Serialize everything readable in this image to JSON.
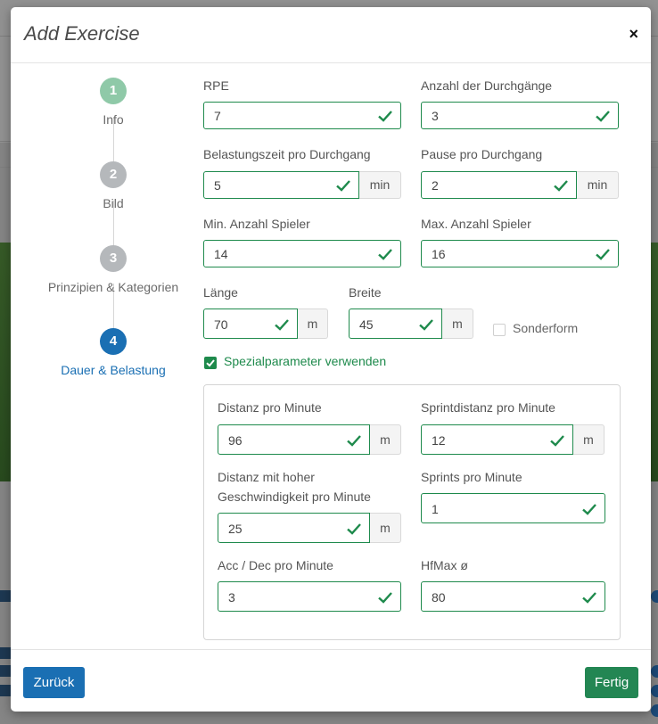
{
  "modal": {
    "title": "Add Exercise",
    "close": "×"
  },
  "steps": [
    {
      "num": "1",
      "label": "Info",
      "state": "done",
      "color": "#8fc9a8"
    },
    {
      "num": "2",
      "label": "Bild",
      "state": "inactive",
      "color": "#b5b8bb"
    },
    {
      "num": "3",
      "label": "Prinzipien & Kategorien",
      "state": "inactive",
      "color": "#b5b8bb"
    },
    {
      "num": "4",
      "label": "Dauer & Belastung",
      "state": "active",
      "color": "#1a6fb3"
    }
  ],
  "form": {
    "rpe": {
      "label": "RPE",
      "value": "7"
    },
    "durchgaenge": {
      "label": "Anzahl der Durchgänge",
      "value": "3"
    },
    "belastungszeit": {
      "label": "Belastungszeit pro Durchgang",
      "value": "5",
      "unit": "min"
    },
    "pause": {
      "label": "Pause pro Durchgang",
      "value": "2",
      "unit": "min"
    },
    "min_spieler": {
      "label": "Min. Anzahl Spieler",
      "value": "14"
    },
    "max_spieler": {
      "label": "Max. Anzahl Spieler",
      "value": "16"
    },
    "laenge": {
      "label": "Länge",
      "value": "70",
      "unit": "m"
    },
    "breite": {
      "label": "Breite",
      "value": "45",
      "unit": "m"
    },
    "sonderform": {
      "label": "Sonderform",
      "checked": false
    },
    "spezialparameter": {
      "label": "Spezialparameter verwenden",
      "checked": true
    }
  },
  "special": {
    "distanz": {
      "label": "Distanz pro Minute",
      "value": "96",
      "unit": "m"
    },
    "sprintdistanz": {
      "label": "Sprintdistanz pro Minute",
      "value": "12",
      "unit": "m"
    },
    "hohe_geschw_line1": "Distanz mit hoher",
    "hohe_geschw_line2": "Geschwindigkeit pro Minute",
    "hohe_geschw": {
      "value": "25",
      "unit": "m"
    },
    "sprints": {
      "label": "Sprints pro Minute",
      "value": "1"
    },
    "accdec": {
      "label": "Acc / Dec pro Minute",
      "value": "3"
    },
    "hfmax": {
      "label": "HfMax ø",
      "value": "80"
    }
  },
  "footer": {
    "back": "Zurück",
    "finish": "Fertig"
  },
  "colors": {
    "valid": "#1e8a4c",
    "primary": "#1a6fb3",
    "success": "#238653"
  },
  "icons": [
    "close-icon",
    "check-icon"
  ]
}
